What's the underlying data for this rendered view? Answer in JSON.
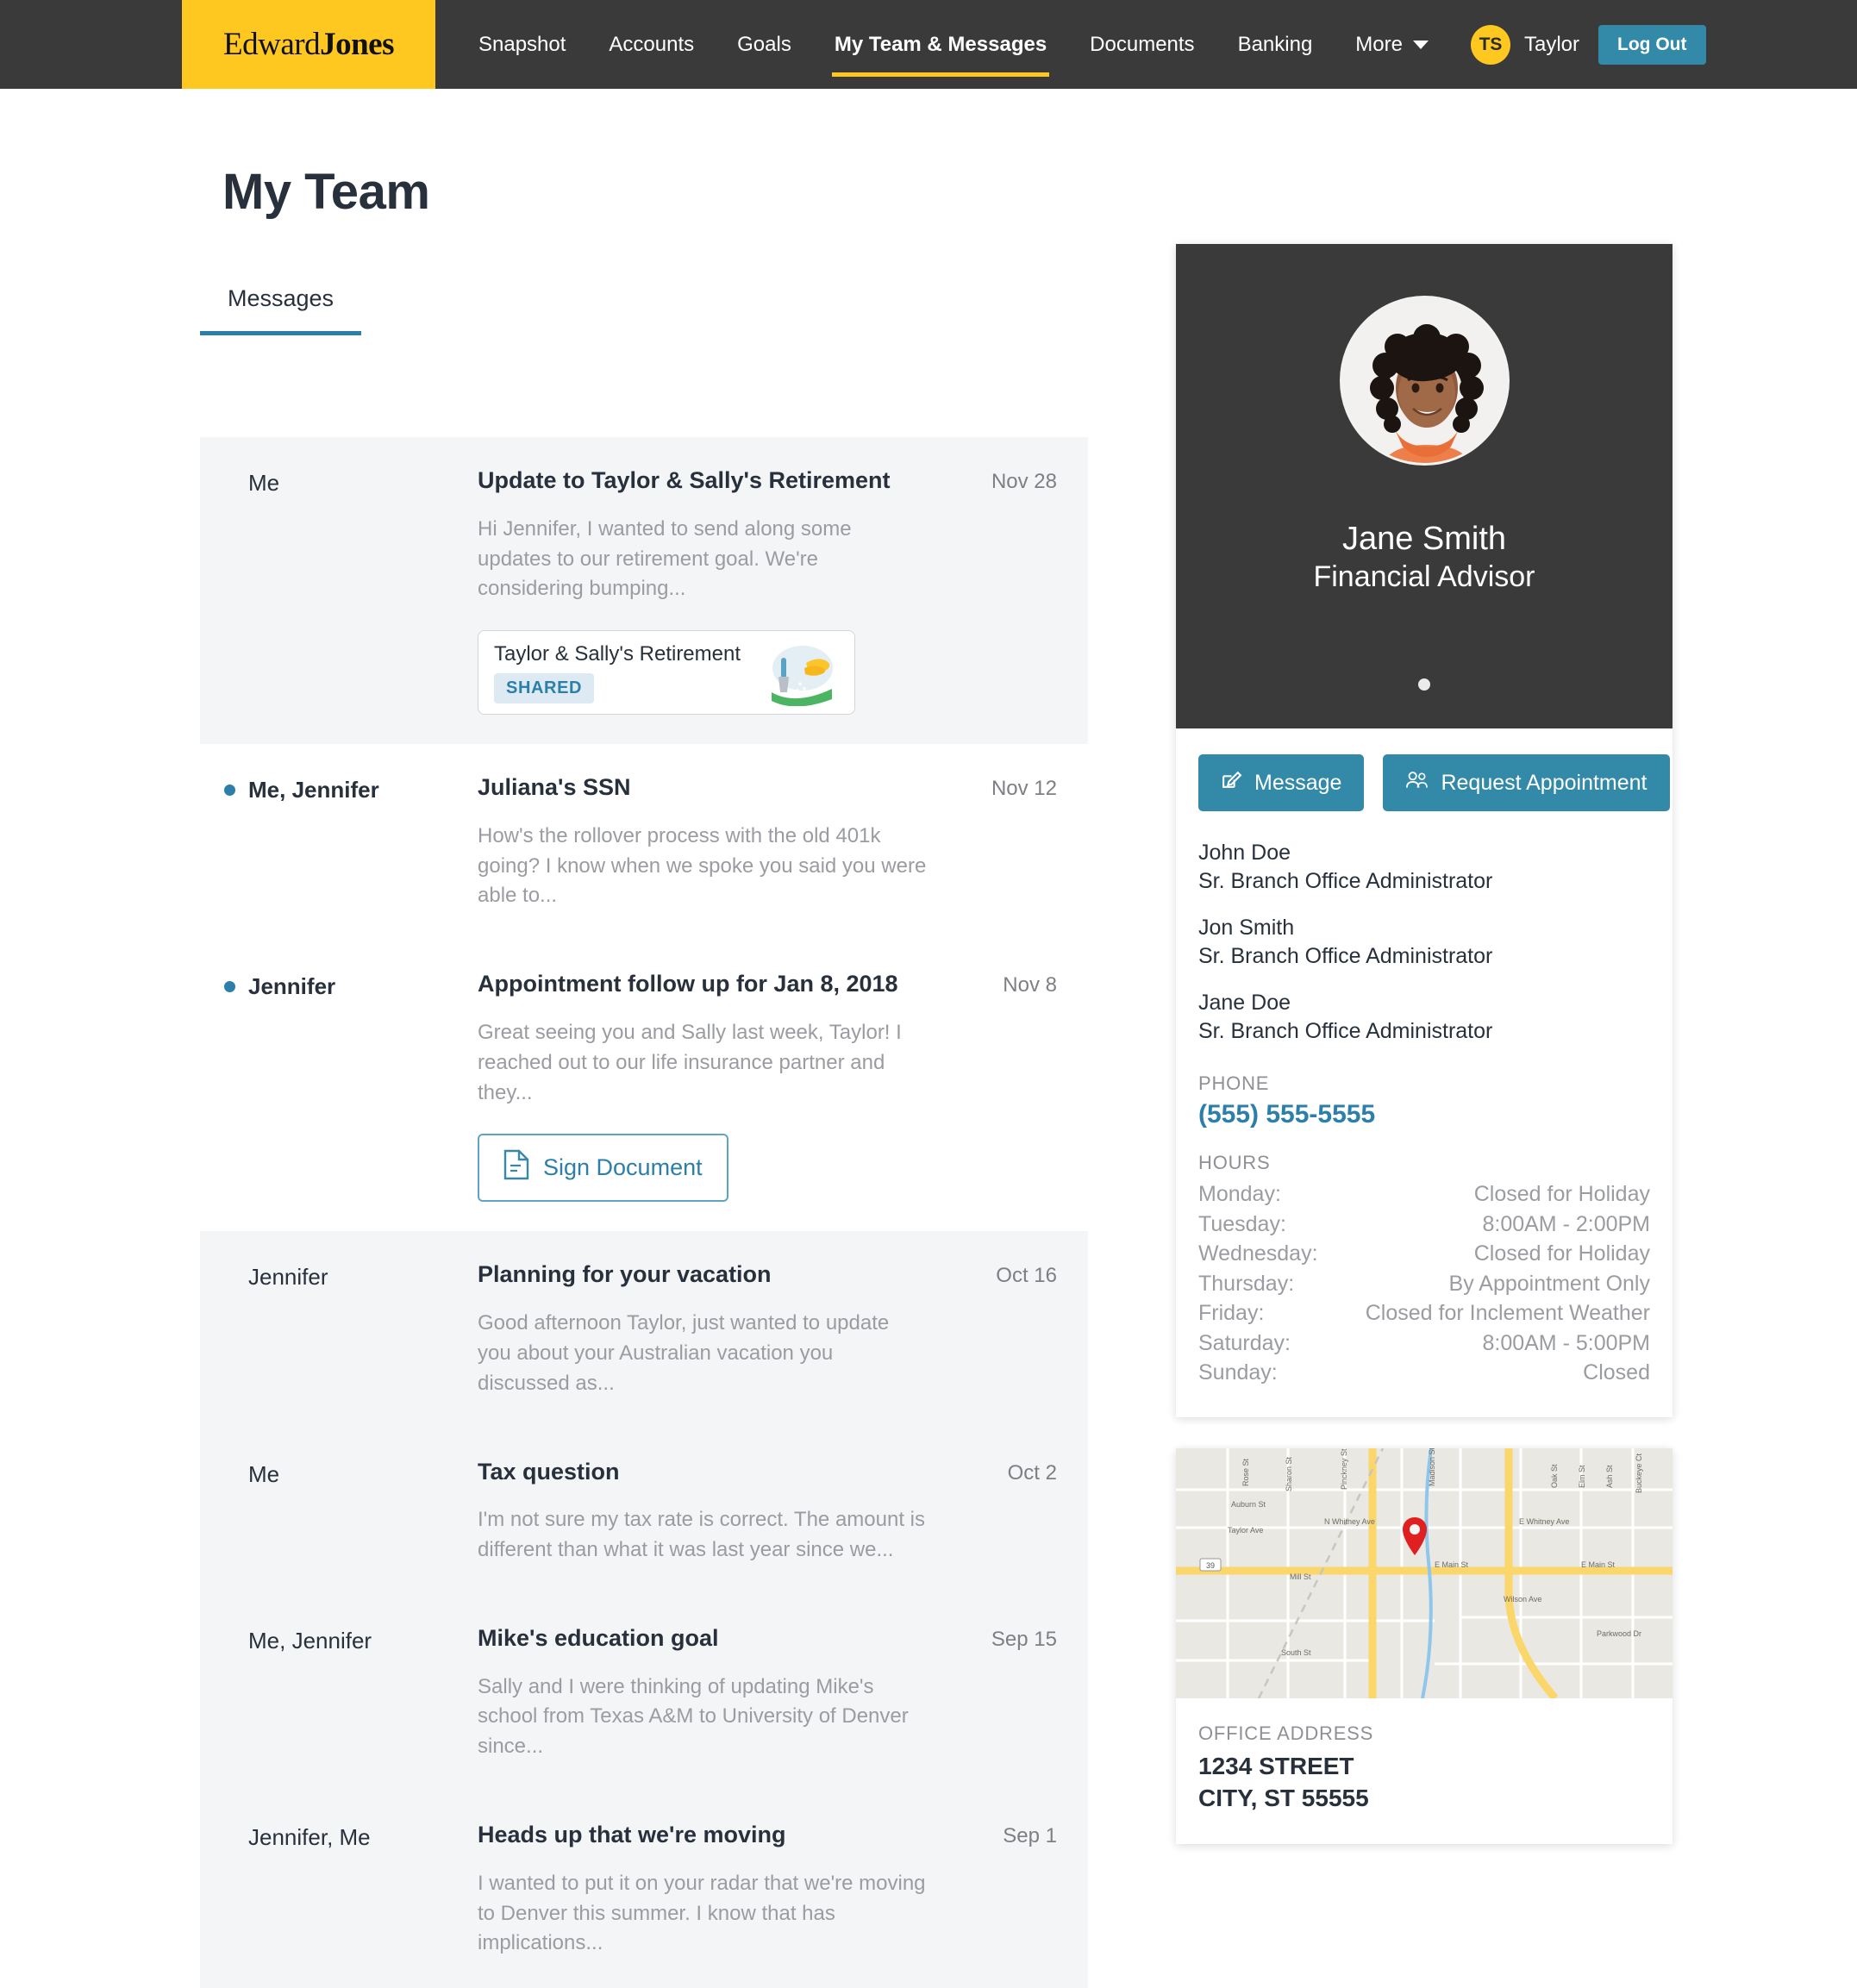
{
  "nav": {
    "logo_part1": "Edward",
    "logo_part2": "Jones",
    "links": [
      {
        "label": "Snapshot",
        "active": false
      },
      {
        "label": "Accounts",
        "active": false
      },
      {
        "label": "Goals",
        "active": false
      },
      {
        "label": "My Team & Messages",
        "active": true
      },
      {
        "label": "Documents",
        "active": false
      },
      {
        "label": "Banking",
        "active": false
      }
    ],
    "more_label": "More",
    "avatar_initials": "TS",
    "user_name": "Taylor",
    "logout_label": "Log Out"
  },
  "page": {
    "title": "My Team"
  },
  "tabs": [
    {
      "label": "Messages",
      "active": true
    }
  ],
  "messages": [
    {
      "sender": "Me",
      "subject": "Update to Taylor & Sally's Retirement",
      "preview": "Hi Jennifer, I wanted to send along some updates to our retirement goal. We're considering bumping...",
      "date": "Nov 28",
      "unread": false,
      "shaded": true,
      "attachment": {
        "type": "goal-chip",
        "title": "Taylor & Sally's Retirement",
        "badge": "SHARED"
      }
    },
    {
      "sender": "Me, Jennifer",
      "subject": "Juliana's SSN",
      "preview": "How's the rollover process with the old 401k going? I know when we spoke you said you were able to...",
      "date": "Nov 12",
      "unread": true,
      "shaded": false,
      "attachment": null
    },
    {
      "sender": "Jennifer",
      "subject": "Appointment follow up for Jan 8, 2018",
      "preview": "Great seeing you and Sally last week, Taylor! I reached out to our life insurance partner and they...",
      "date": "Nov 8",
      "unread": true,
      "shaded": false,
      "attachment": {
        "type": "sign-document",
        "label": "Sign Document"
      }
    },
    {
      "sender": "Jennifer",
      "subject": "Planning for your vacation",
      "preview": "Good afternoon Taylor, just wanted to update you about your Australian vacation you discussed as...",
      "date": "Oct 16",
      "unread": false,
      "shaded": true,
      "attachment": null
    },
    {
      "sender": "Me",
      "subject": "Tax question",
      "preview": "I'm not sure my tax rate is correct. The amount is different than what it was last year since we...",
      "date": "Oct 2",
      "unread": false,
      "shaded": true,
      "attachment": null
    },
    {
      "sender": "Me, Jennifer",
      "subject": "Mike's education goal",
      "preview": "Sally and I were thinking of updating Mike's school from Texas A&M to University of Denver since...",
      "date": "Sep 15",
      "unread": false,
      "shaded": true,
      "attachment": null
    },
    {
      "sender": "Jennifer, Me",
      "subject": "Heads up that we're moving",
      "preview": "I wanted to put it on your radar that we're moving to Denver this summer. I know that has implications...",
      "date": "Sep 1",
      "unread": false,
      "shaded": true,
      "attachment": null
    }
  ],
  "advisor": {
    "name": "Jane Smith",
    "role": "Financial Advisor",
    "message_button": "Message",
    "appointment_button": "Request Appointment",
    "staff": [
      {
        "name": "John Doe",
        "role": "Sr. Branch Office Administrator"
      },
      {
        "name": "Jon Smith",
        "role": "Sr. Branch Office Administrator"
      },
      {
        "name": "Jane Doe",
        "role": "Sr. Branch Office Administrator"
      }
    ],
    "phone_label": "PHONE",
    "phone": "(555) 555-5555",
    "hours_label": "HOURS",
    "hours": [
      {
        "day": "Monday:",
        "value": "Closed for Holiday"
      },
      {
        "day": "Tuesday:",
        "value": "8:00AM - 2:00PM"
      },
      {
        "day": "Wednesday:",
        "value": "Closed for Holiday"
      },
      {
        "day": "Thursday:",
        "value": "By Appointment Only"
      },
      {
        "day": "Friday:",
        "value": "Closed for Inclement Weather"
      },
      {
        "day": "Saturday:",
        "value": "8:00AM - 5:00PM"
      },
      {
        "day": "Sunday:",
        "value": "Closed"
      }
    ]
  },
  "office": {
    "address_label": "OFFICE ADDRESS",
    "line1": "1234 STREET",
    "line2": "CITY, ST 55555",
    "map_labels": [
      "E Main St",
      "E Main St",
      "N Whitney Ave",
      "E Whitney Ave",
      "Oak St",
      "Elm St",
      "Madison St",
      "South St",
      "Wilson Ave",
      "Parkwood Dr"
    ]
  },
  "colors": {
    "brand_yellow": "#ffc820",
    "nav_dark": "#3a3a3a",
    "accent_teal": "#2c7fa8",
    "button_teal": "#3389a8",
    "text_dark": "#28303c",
    "text_muted": "#9a9ca1",
    "row_shaded": "#f4f5f7",
    "map_pin": "#e02020"
  }
}
